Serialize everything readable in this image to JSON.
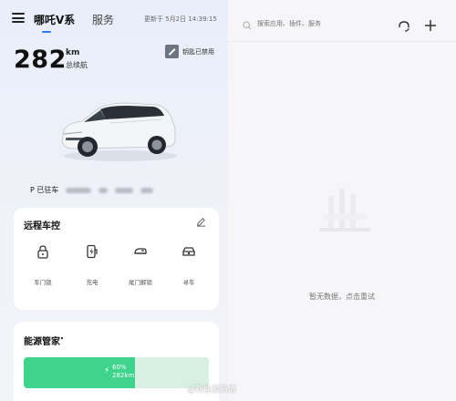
{
  "header": {
    "tab_brand": "哪吒V系",
    "tab_service": "服务",
    "update_time": "更新于 5月2日 14:39:15"
  },
  "vehicle": {
    "range_value": "282",
    "range_unit": "km",
    "range_label": "总续航",
    "key_status": "钥匙已禁用",
    "plate_prefix": "P 已驻车"
  },
  "remote": {
    "title": "远程车控",
    "controls": [
      {
        "label": "车门锁",
        "icon": "lock-icon"
      },
      {
        "label": "充电",
        "icon": "charge-icon"
      },
      {
        "label": "尾门解锁",
        "icon": "trunk-icon"
      },
      {
        "label": "寻车",
        "icon": "find-car-icon"
      }
    ]
  },
  "energy": {
    "title": "能源管家",
    "battery_percent": "60%",
    "battery_fraction": 0.6,
    "battery_range": "282km"
  },
  "right_panel": {
    "search_placeholder": "搜索应用、插件、服务",
    "empty_message": "暂无数据，点击重试"
  },
  "watermark": "@新能源商情",
  "colors": {
    "accent": "#2b7bff",
    "battery_fill": "#3ed48b",
    "battery_track": "#d6f0e2"
  }
}
